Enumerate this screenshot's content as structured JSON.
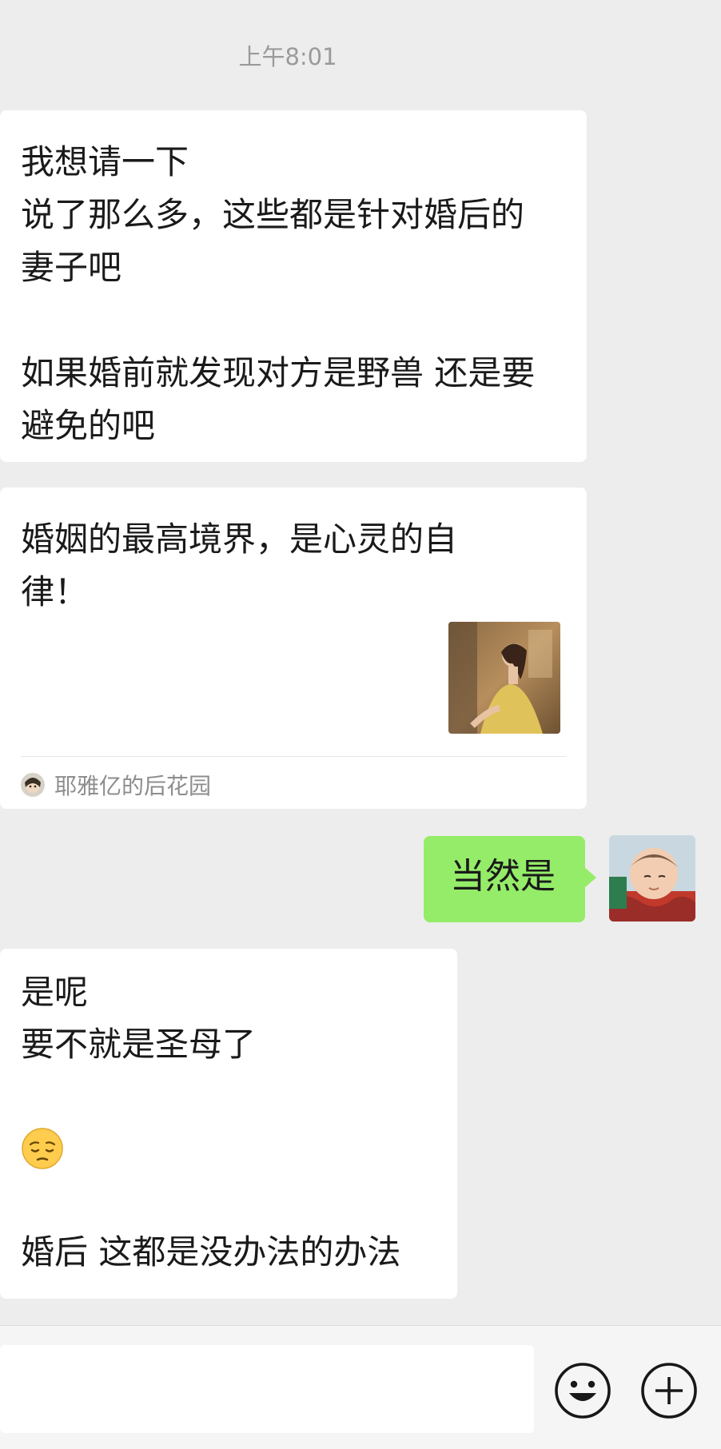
{
  "timestamp": "上午8:01",
  "messages": [
    {
      "side": "left",
      "lines": [
        "我想请一下",
        "说了那么多，这些都是针对婚后的",
        "妻子吧",
        "",
        "如果婚前就发现对方是野兽 还是要",
        "避免的吧"
      ]
    },
    {
      "side": "left",
      "type": "link-card",
      "title": "婚姻的最高境界，是心灵的自律！",
      "source": "耶雅亿的后花园"
    },
    {
      "side": "right",
      "text": "当然是"
    },
    {
      "side": "left",
      "lines_before": [
        "是呢",
        "要不就是圣母了",
        ""
      ],
      "emoji": "pensive-face",
      "lines_after": [
        "",
        "婚后 这都是没办法的办法"
      ]
    }
  ],
  "input_bar": {
    "placeholder": "",
    "emoji_button": "smiley-icon",
    "more_button": "plus-icon"
  },
  "colors": {
    "background": "#ededed",
    "incoming_bubble": "#ffffff",
    "outgoing_bubble": "#95ec69",
    "timestamp": "#9a9a9a"
  }
}
